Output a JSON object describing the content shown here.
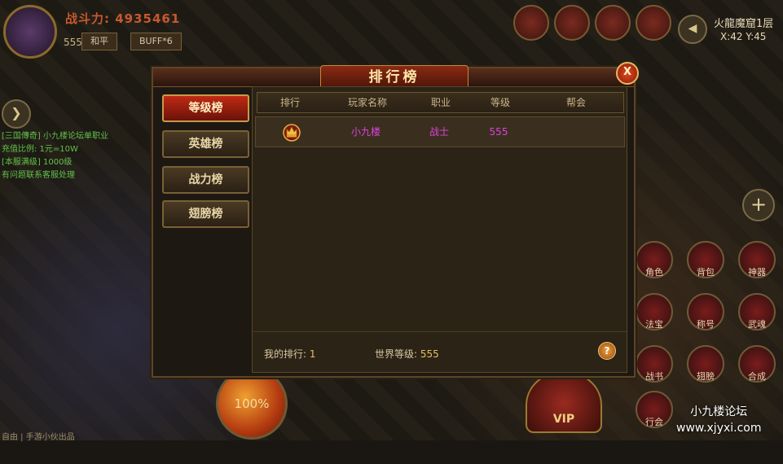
{
  "hud": {
    "power_text": "战斗力: 4935461",
    "level": "555",
    "mode": "和平",
    "buff": "BUFF*6",
    "map_name": "火龍魔窟1层",
    "coords": "X:42 Y:45",
    "chat": [
      "[三国傳奇] 小九楼论坛单职业",
      "充值比例: 1元=10W",
      "[本服满级] 1000级",
      "有问题联系客服处理"
    ],
    "hp_percent": "100%",
    "vip_label": "VIP",
    "bottom_text": "自由 | 手游小伙出品"
  },
  "char_buttons": [
    "角色",
    "背包",
    "神器",
    "法宝",
    "称号",
    "武魂",
    "战书",
    "翅膀",
    "合成",
    "行会"
  ],
  "panel": {
    "title": "排行榜",
    "close_label": "X",
    "tabs": [
      {
        "label": "等级榜",
        "active": true
      },
      {
        "label": "英雄榜",
        "active": false
      },
      {
        "label": "战力榜",
        "active": false
      },
      {
        "label": "翅膀榜",
        "active": false
      }
    ],
    "columns": [
      "排行",
      "玩家名称",
      "职业",
      "等级",
      "帮会"
    ],
    "rows": [
      {
        "rank_icon": "crown-icon",
        "name": "小九楼",
        "class": "战士",
        "level": "555",
        "guild": ""
      }
    ],
    "my_rank_label": "我的排行:",
    "my_rank_value": "1",
    "world_level_label": "世界等级:",
    "world_level_value": "555",
    "help_label": "?"
  },
  "watermark": {
    "line1": "小九楼论坛",
    "line2": "www.xjyxi.com"
  },
  "colors": {
    "accent": "#c02a14",
    "player_name": "#e040e0",
    "gold": "#e8c060"
  }
}
